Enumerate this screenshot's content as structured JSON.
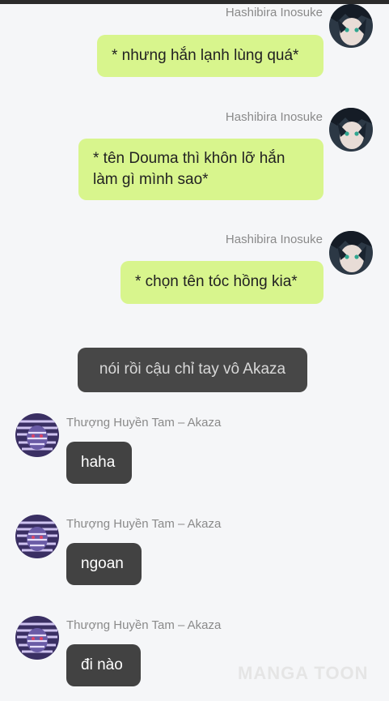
{
  "messages": [
    {
      "sender": "Hashibira Inosuke",
      "text": "* nhưng hắn lạnh lùng quá*"
    },
    {
      "sender": "Hashibira Inosuke",
      "text": "* tên Douma thì khôn lỡ hắn làm gì mình sao*"
    },
    {
      "sender": "Hashibira Inosuke",
      "text": "* chọn tên tóc hồng kia*"
    },
    {
      "system": "nói rồi cậu chỉ tay vô Akaza"
    },
    {
      "sender": "Thượng Huyền Tam – Akaza",
      "text": "haha"
    },
    {
      "sender": "Thượng Huyền Tam – Akaza",
      "text": "ngoan"
    },
    {
      "sender": "Thượng Huyền Tam – Akaza",
      "text": "đi nào"
    }
  ],
  "watermark": "MANGA TOON",
  "colors": {
    "background": "#f5f6f8",
    "outgoing_bubble": "#d8f58d",
    "incoming_bubble": "#424242",
    "system_bubble": "#474747",
    "sender_name": "#8a8a8a"
  },
  "icons": {
    "right_avatar": "inosuke-avatar-icon",
    "left_avatar": "akaza-avatar-icon"
  }
}
